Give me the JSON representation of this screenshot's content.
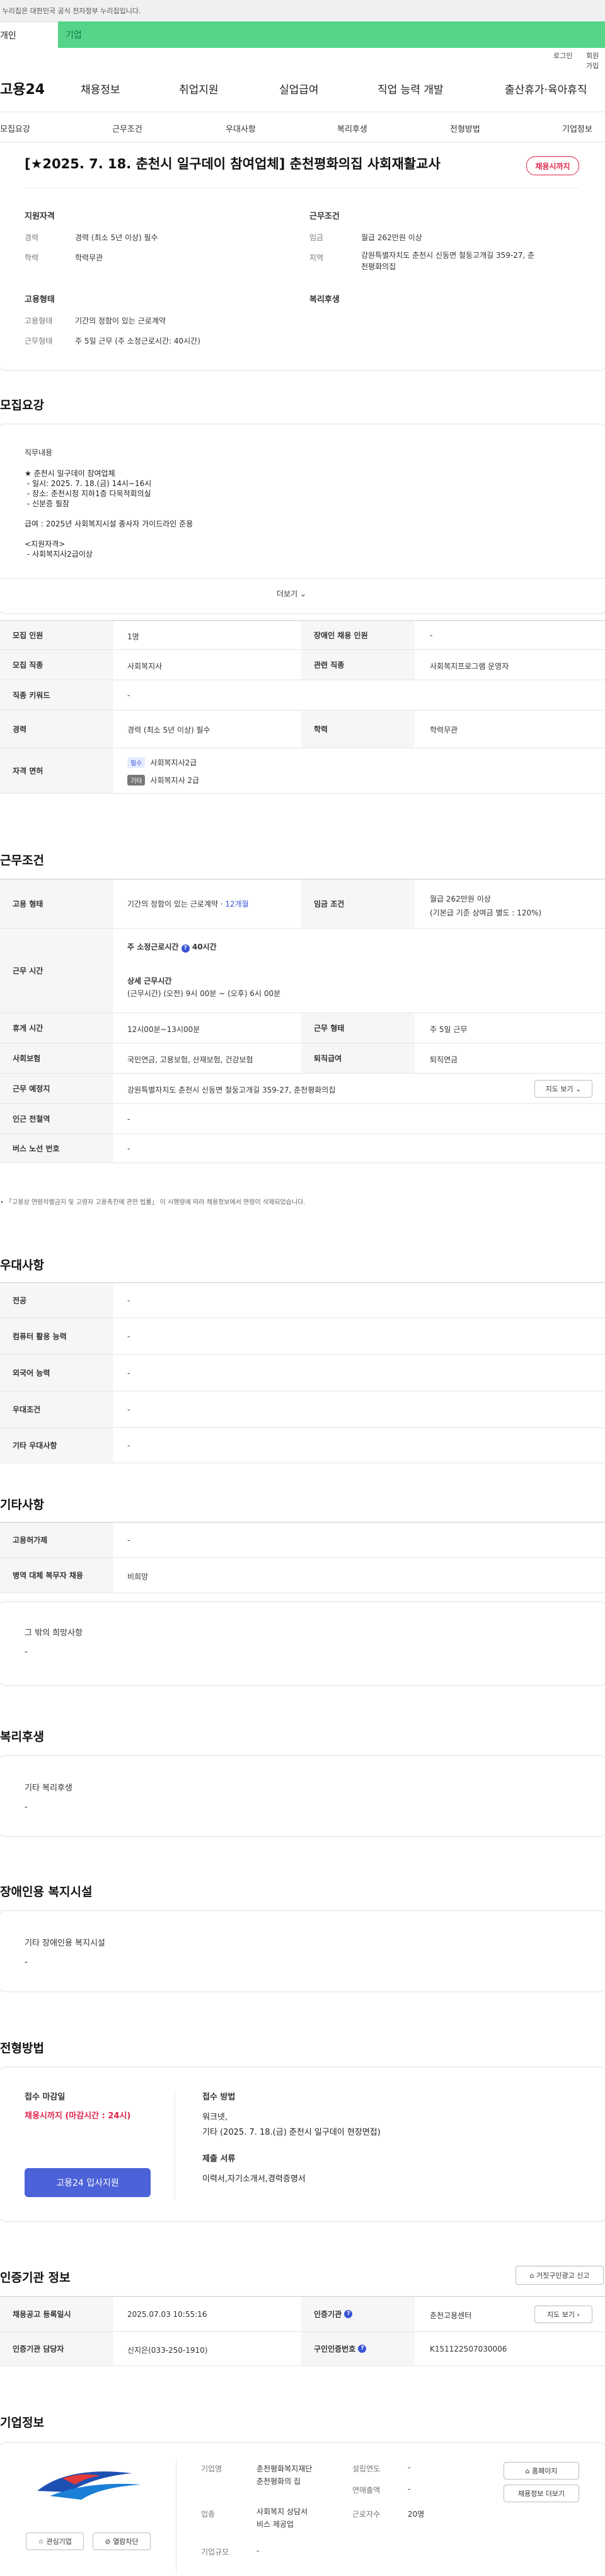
{
  "notice": "이 누리집은 대한민국 공식 전자정부 누리집입니다.",
  "site_tabs": {
    "personal": "개인",
    "business": "기업"
  },
  "utility": {
    "login": "로그인",
    "join": "회원가입"
  },
  "logo": "고용24",
  "gnb": [
    "채용정보",
    "취업지원",
    "실업급여",
    "직업 능력 개발",
    "출산휴가·육아휴직"
  ],
  "anchors": [
    "모집요강",
    "근무조건",
    "우대사항",
    "복리후생",
    "전형방법",
    "기업정보"
  ],
  "summary": {
    "title": "[★2025. 7. 18. 춘천시 일구데이 참여업체] 춘천평화의집 사회재활교사",
    "status_badge": "채용시까지",
    "qual_heading": "지원자격",
    "career_label": "경력",
    "career_value": "경력 (최소 5년 이상) 필수",
    "edu_label": "학력",
    "edu_value": "학력무관",
    "cond_heading": "근무조건",
    "wage_label": "임금",
    "wage_value": "월급 262만원 이상",
    "region_label": "지역",
    "region_value_1": "강원특별자치도 춘천시 신동면 철둥고개길 359-27, 춘",
    "region_value_2": "천평화의집",
    "emp_heading": "고용형태",
    "emp_label": "고용형태",
    "emp_value": "기간의 정함이 있는 근로계약",
    "work_label": "근무형태",
    "work_value": "주 5일 근무 (주 소정근로시간: 40시간)",
    "welfare_heading": "복리후생"
  },
  "recruit": {
    "heading": "모집요강",
    "job_desc_title": "직무내용",
    "job_desc_lines": [
      "★ 춘천시 일구데이 참여업체",
      " - 일시: 2025. 7. 18.(금) 14시~16시",
      " - 장소: 춘천시청 지하1층 다목적회의실",
      " - 신분증 필참",
      "",
      "급여 : 2025년 사회복지시설 종사자 가이드라인 준용",
      "",
      "<지원자격>",
      " - 사회복지사2급이상"
    ],
    "more": "더보기",
    "rows": {
      "headcount_label": "모집 인원",
      "headcount_value": "1명",
      "disabled_label": "장애인 채용 인원",
      "disabled_value": "-",
      "job_label": "모집 직종",
      "job_value": "사회복지사",
      "related_label": "관련 직종",
      "related_value": "사회복지프로그램 운영자",
      "keyword_label": "직종 키워드",
      "keyword_value": "-",
      "career_label": "경력",
      "career_value": "경력 (최소 5년 이상) 필수",
      "edu_label": "학력",
      "edu_value": "학력무관",
      "license_label": "자격 면허",
      "license_1_tag": "필수",
      "license_1": "사회복지사2급",
      "license_2_tag": "기타",
      "license_2": "사회복지사 2급"
    }
  },
  "conditions": {
    "heading": "근무조건",
    "emp_label": "고용 형태",
    "emp_value": "기간의 정함이 있는 근로계약 · ",
    "emp_months": "12개월",
    "wage_label": "임금 조건",
    "wage_value_1": "월급 262만원 이상",
    "wage_value_2": "(기본급 기준 상여금 별도 : 120%)",
    "hours_label": "근무 시간",
    "hours_week": "주 소정근로시간",
    "hours_week_value": "40시간",
    "hours_detail_title": "상세 근무시간",
    "hours_detail": "(근무시간) (오전) 9시 00분 ~ (오후) 6시 00분",
    "rest_label": "휴게 시간",
    "rest_value": "12시00분~13시00분",
    "type_label": "근무 형태",
    "type_value": "주 5일 근무",
    "ins_label": "사회보험",
    "ins_value": "국민연금, 고용보험, 산재보험, 건강보험",
    "retire_label": "퇴직급여",
    "retire_value": "퇴직연금",
    "place_label": "근무 예정지",
    "place_value": "강원특별자치도 춘천시 신동면 철둥고개길 359-27, 춘천평화의집",
    "map_btn": "지도 보기",
    "station_label": "인근 전철역",
    "station_value": "-",
    "bus_label": "버스 노선 번호",
    "bus_value": "-",
    "note": "「고용상 연령차별금지 및 고령자 고용촉진에 관한 법률」 이 시행령에 따라 채용정보에서 연령이 삭제되었습니다."
  },
  "preference": {
    "heading": "우대사항",
    "rows": [
      {
        "label": "전공",
        "value": "-"
      },
      {
        "label": "컴퓨터 활용 능력",
        "value": "-"
      },
      {
        "label": "외국어 능력",
        "value": "-"
      },
      {
        "label": "우대조건",
        "value": "-"
      },
      {
        "label": "기타 우대사항",
        "value": "-"
      }
    ]
  },
  "etc": {
    "heading": "기타사항",
    "rows": [
      {
        "label": "고용허가제",
        "value": "-"
      },
      {
        "label": "병역 대체 복무자 채용",
        "value": "비희망"
      }
    ],
    "hope_title": "그 밖의 희망사항",
    "hope_value": "-"
  },
  "welfare": {
    "heading": "복리후생",
    "box_title": "기타 복리후생",
    "box_value": "-"
  },
  "disabled_facility": {
    "heading": "장애인용 복지시설",
    "box_title": "기타 장애인용 복지시설",
    "box_value": "-"
  },
  "selection": {
    "heading": "전형방법",
    "deadline_title": "접수 마감일",
    "deadline_value": "채용시까지 (마감시간 : 24시)",
    "apply_btn": "고용24 입사지원",
    "method_title": "접수 방법",
    "method_1": "워크넷,",
    "method_2": "기타 (2025. 7. 18.(금) 춘천시 일구데이 현장면접)",
    "docs_title": "제출 서류",
    "docs_value": "이력서,자기소개서,경력증명서"
  },
  "cert": {
    "heading": "인증기관 정보",
    "report_btn": "거짓구인광고 신고",
    "reg_label": "채용공고 등록일시",
    "reg_value": "2025.07.03 10:55:16",
    "agency_label": "인증기관",
    "agency_value": "춘천고용센터",
    "map_btn": "지도 보기",
    "manager_label": "인증기관 담당자",
    "manager_value": "신지은(033-250-1910)",
    "cert_no_label": "구인인증번호",
    "cert_no_value": "K151122507030006"
  },
  "company": {
    "heading": "기업정보",
    "fav_btn": "관심기업",
    "block_btn": "열람차단",
    "name_label": "기업명",
    "name_value_1": "춘천평화복지재단",
    "name_value_2": "춘천평화의 집",
    "founded_label": "설립연도",
    "founded_value": "-",
    "sales_label": "연매출액",
    "sales_value": "-",
    "industry_label": "업종",
    "industry_value_1": "사회복지 상담서",
    "industry_value_2": "비스 제공업",
    "workers_label": "근로자수",
    "workers_value": "20명",
    "scale_label": "기업규모",
    "scale_value": "-",
    "homepage_btn": "홈페이지",
    "more_jobs_btn": "채용정보 더보기"
  },
  "colors": {
    "accent": "#56d48a",
    "brand_blue": "#4c62d8",
    "alert_red": "#e0264b"
  }
}
